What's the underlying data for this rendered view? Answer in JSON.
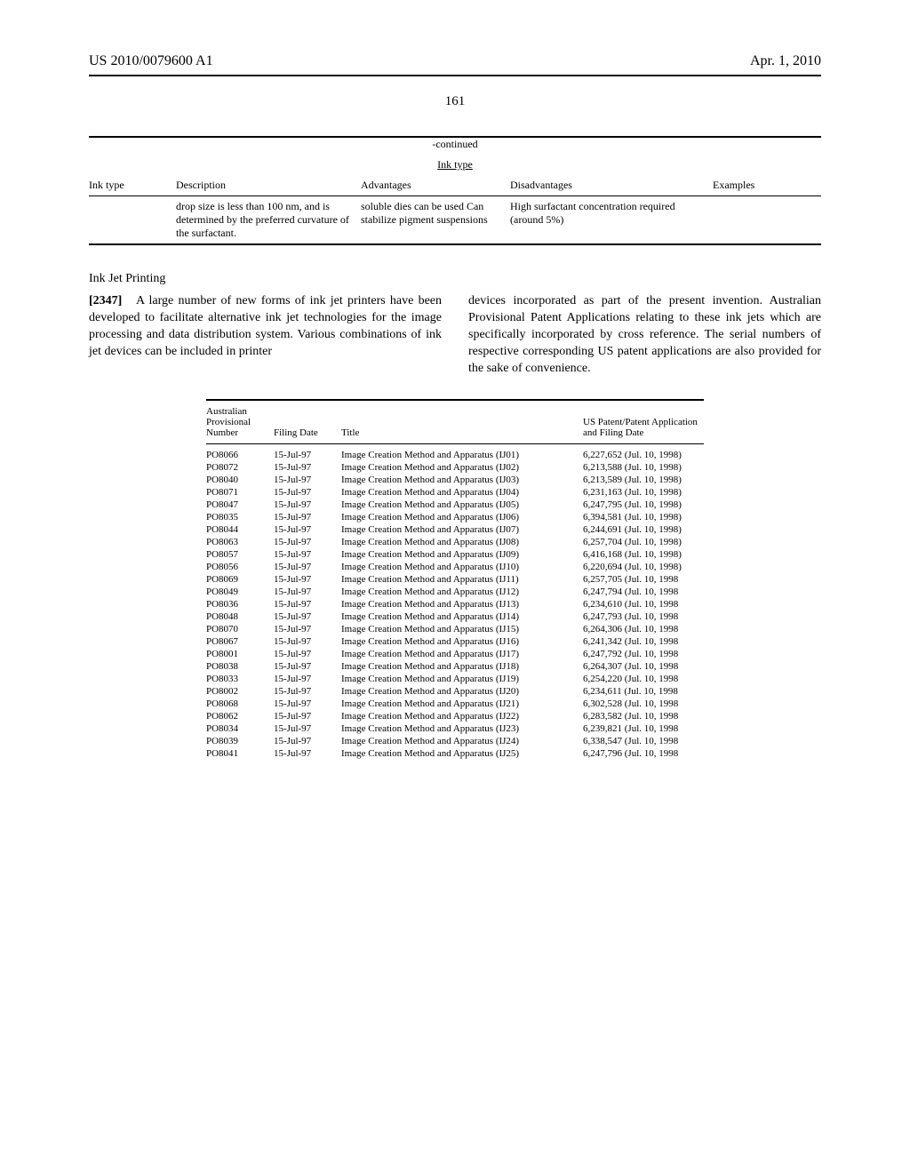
{
  "header": {
    "pub_number": "US 2010/0079600 A1",
    "pub_date": "Apr. 1, 2010"
  },
  "page_number": "161",
  "table1": {
    "continued": "-continued",
    "title": "Ink type",
    "headers": {
      "c1": "Ink type",
      "c2": "Description",
      "c3": "Advantages",
      "c4": "Disadvantages",
      "c5": "Examples"
    },
    "row": {
      "c1": "",
      "c2": "drop size is less than 100 nm, and is determined by the preferred curvature of the surfactant.",
      "c3": "soluble dies can be used Can stabilize pigment suspensions",
      "c4": "High surfactant concentration required (around 5%)",
      "c5": ""
    }
  },
  "section": {
    "head": "Ink Jet Printing",
    "para_num": "[2347]",
    "col1": "A large number of new forms of ink jet printers have been developed to facilitate alternative ink jet technologies for the image processing and data distribution system. Various combinations of ink jet devices can be included in printer",
    "col2": "devices incorporated as part of the present invention. Australian Provisional Patent Applications relating to these ink jets which are specifically incorporated by cross reference. The serial numbers of respective corresponding US patent applications are also provided for the sake of convenience."
  },
  "table2": {
    "headers": {
      "c1": "Australian Provisional Number",
      "c2": "Filing Date",
      "c3": "Title",
      "c4": "US Patent/Patent Application and Filing Date"
    },
    "rows": [
      {
        "num": "PO8066",
        "date": "15-Jul-97",
        "title": "Image Creation Method and Apparatus (IJ01)",
        "us": "6,227,652 (Jul. 10, 1998)"
      },
      {
        "num": "PO8072",
        "date": "15-Jul-97",
        "title": "Image Creation Method and Apparatus (IJ02)",
        "us": "6,213,588 (Jul. 10, 1998)"
      },
      {
        "num": "PO8040",
        "date": "15-Jul-97",
        "title": "Image Creation Method and Apparatus (IJ03)",
        "us": "6,213,589 (Jul. 10, 1998)"
      },
      {
        "num": "PO8071",
        "date": "15-Jul-97",
        "title": "Image Creation Method and Apparatus (IJ04)",
        "us": "6,231,163 (Jul. 10, 1998)"
      },
      {
        "num": "PO8047",
        "date": "15-Jul-97",
        "title": "Image Creation Method and Apparatus (IJ05)",
        "us": "6,247,795 (Jul. 10, 1998)"
      },
      {
        "num": "PO8035",
        "date": "15-Jul-97",
        "title": "Image Creation Method and Apparatus (IJ06)",
        "us": "6,394,581 (Jul. 10, 1998)"
      },
      {
        "num": "PO8044",
        "date": "15-Jul-97",
        "title": "Image Creation Method and Apparatus (IJ07)",
        "us": "6,244,691 (Jul. 10, 1998)"
      },
      {
        "num": "PO8063",
        "date": "15-Jul-97",
        "title": "Image Creation Method and Apparatus (IJ08)",
        "us": "6,257,704 (Jul. 10, 1998)"
      },
      {
        "num": "PO8057",
        "date": "15-Jul-97",
        "title": "Image Creation Method and Apparatus (IJ09)",
        "us": "6,416,168 (Jul. 10, 1998)"
      },
      {
        "num": "PO8056",
        "date": "15-Jul-97",
        "title": "Image Creation Method and Apparatus (IJ10)",
        "us": "6,220,694 (Jul. 10, 1998)"
      },
      {
        "num": "PO8069",
        "date": "15-Jul-97",
        "title": "Image Creation Method and Apparatus (IJ11)",
        "us": "6,257,705 (Jul. 10, 1998"
      },
      {
        "num": "PO8049",
        "date": "15-Jul-97",
        "title": "Image Creation Method and Apparatus (IJ12)",
        "us": "6,247,794 (Jul. 10, 1998"
      },
      {
        "num": "PO8036",
        "date": "15-Jul-97",
        "title": "Image Creation Method and Apparatus (IJ13)",
        "us": "6,234,610 (Jul. 10, 1998"
      },
      {
        "num": "PO8048",
        "date": "15-Jul-97",
        "title": "Image Creation Method and Apparatus (IJ14)",
        "us": "6,247,793 (Jul. 10, 1998"
      },
      {
        "num": "PO8070",
        "date": "15-Jul-97",
        "title": "Image Creation Method and Apparatus (IJ15)",
        "us": "6,264,306 (Jul. 10, 1998"
      },
      {
        "num": "PO8067",
        "date": "15-Jul-97",
        "title": "Image Creation Method and Apparatus (IJ16)",
        "us": "6,241,342 (Jul. 10, 1998"
      },
      {
        "num": "PO8001",
        "date": "15-Jul-97",
        "title": "Image Creation Method and Apparatus (IJ17)",
        "us": "6,247,792 (Jul. 10, 1998"
      },
      {
        "num": "PO8038",
        "date": "15-Jul-97",
        "title": "Image Creation Method and Apparatus (IJ18)",
        "us": "6,264,307 (Jul. 10, 1998"
      },
      {
        "num": "PO8033",
        "date": "15-Jul-97",
        "title": "Image Creation Method and Apparatus (IJ19)",
        "us": "6,254,220 (Jul. 10, 1998"
      },
      {
        "num": "PO8002",
        "date": "15-Jul-97",
        "title": "Image Creation Method and Apparatus (IJ20)",
        "us": "6,234,611 (Jul. 10, 1998"
      },
      {
        "num": "PO8068",
        "date": "15-Jul-97",
        "title": "Image Creation Method and Apparatus (IJ21)",
        "us": "6,302,528 (Jul. 10, 1998"
      },
      {
        "num": "PO8062",
        "date": "15-Jul-97",
        "title": "Image Creation Method and Apparatus (IJ22)",
        "us": "6,283,582 (Jul. 10, 1998"
      },
      {
        "num": "PO8034",
        "date": "15-Jul-97",
        "title": "Image Creation Method and Apparatus (IJ23)",
        "us": "6,239,821 (Jul. 10, 1998"
      },
      {
        "num": "PO8039",
        "date": "15-Jul-97",
        "title": "Image Creation Method and Apparatus (IJ24)",
        "us": "6,338,547 (Jul. 10, 1998"
      },
      {
        "num": "PO8041",
        "date": "15-Jul-97",
        "title": "Image Creation Method and Apparatus (IJ25)",
        "us": "6,247,796 (Jul. 10, 1998"
      }
    ]
  }
}
